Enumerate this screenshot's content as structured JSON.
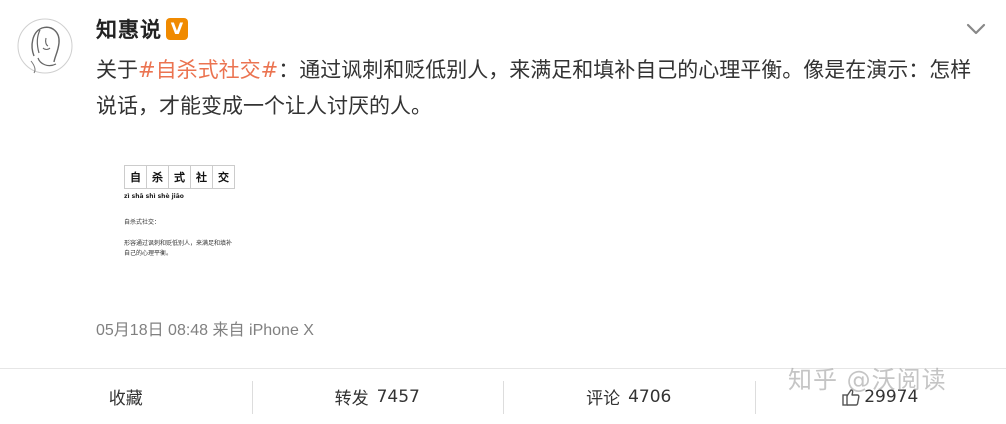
{
  "author": {
    "name": "知惠说",
    "verified_badge": "V"
  },
  "post": {
    "prefix": "关于",
    "hashtag": "#自杀式社交#",
    "body": "：通过讽刺和贬低别人，来满足和填补自己的心理平衡。像是在演示：怎样说话，才能变成一个让人讨厌的人。"
  },
  "image_card": {
    "term_chars": [
      "自",
      "杀",
      "式",
      "社",
      "交"
    ],
    "pinyin": "zì shā shì shè jiāo",
    "heading": "自杀式社交：",
    "definition": "形容通过讽刺和贬低别人，来满足和填补自己的心理平衡。"
  },
  "meta": {
    "time": "05月18日 08:48",
    "source_prefix": "来自",
    "source": "iPhone X"
  },
  "actions": {
    "favorite_label": "收藏",
    "repost_label": "转发",
    "repost_count": "7457",
    "comment_label": "评论",
    "comment_count": "4706",
    "like_count": "29974"
  },
  "watermark": "知乎 @沃阅读",
  "icons": {
    "avatar": "avatar-sketch-icon",
    "verified": "verified-v-icon",
    "menu": "chevron-down-icon",
    "like": "thumbs-up-icon"
  },
  "colors": {
    "hashtag": "#eb7350",
    "verified_badge": "#f08a00",
    "meta_text": "#808080"
  }
}
